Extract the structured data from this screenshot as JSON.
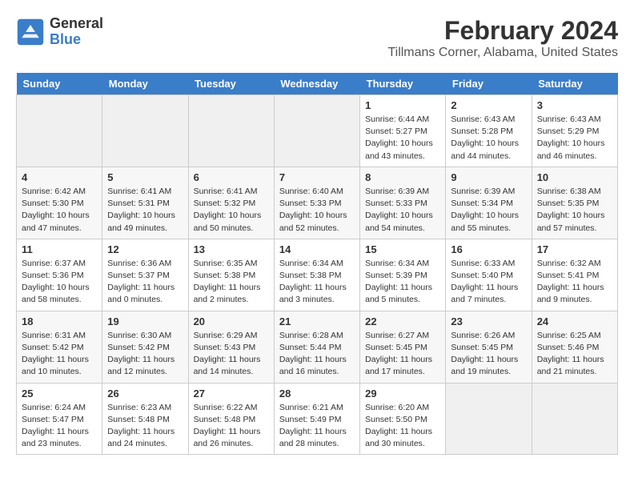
{
  "logo": {
    "text_general": "General",
    "text_blue": "Blue"
  },
  "title": "February 2024",
  "subtitle": "Tillmans Corner, Alabama, United States",
  "days_header": [
    "Sunday",
    "Monday",
    "Tuesday",
    "Wednesday",
    "Thursday",
    "Friday",
    "Saturday"
  ],
  "weeks": [
    [
      {
        "num": "",
        "info": ""
      },
      {
        "num": "",
        "info": ""
      },
      {
        "num": "",
        "info": ""
      },
      {
        "num": "",
        "info": ""
      },
      {
        "num": "1",
        "info": "Sunrise: 6:44 AM\nSunset: 5:27 PM\nDaylight: 10 hours\nand 43 minutes."
      },
      {
        "num": "2",
        "info": "Sunrise: 6:43 AM\nSunset: 5:28 PM\nDaylight: 10 hours\nand 44 minutes."
      },
      {
        "num": "3",
        "info": "Sunrise: 6:43 AM\nSunset: 5:29 PM\nDaylight: 10 hours\nand 46 minutes."
      }
    ],
    [
      {
        "num": "4",
        "info": "Sunrise: 6:42 AM\nSunset: 5:30 PM\nDaylight: 10 hours\nand 47 minutes."
      },
      {
        "num": "5",
        "info": "Sunrise: 6:41 AM\nSunset: 5:31 PM\nDaylight: 10 hours\nand 49 minutes."
      },
      {
        "num": "6",
        "info": "Sunrise: 6:41 AM\nSunset: 5:32 PM\nDaylight: 10 hours\nand 50 minutes."
      },
      {
        "num": "7",
        "info": "Sunrise: 6:40 AM\nSunset: 5:33 PM\nDaylight: 10 hours\nand 52 minutes."
      },
      {
        "num": "8",
        "info": "Sunrise: 6:39 AM\nSunset: 5:33 PM\nDaylight: 10 hours\nand 54 minutes."
      },
      {
        "num": "9",
        "info": "Sunrise: 6:39 AM\nSunset: 5:34 PM\nDaylight: 10 hours\nand 55 minutes."
      },
      {
        "num": "10",
        "info": "Sunrise: 6:38 AM\nSunset: 5:35 PM\nDaylight: 10 hours\nand 57 minutes."
      }
    ],
    [
      {
        "num": "11",
        "info": "Sunrise: 6:37 AM\nSunset: 5:36 PM\nDaylight: 10 hours\nand 58 minutes."
      },
      {
        "num": "12",
        "info": "Sunrise: 6:36 AM\nSunset: 5:37 PM\nDaylight: 11 hours\nand 0 minutes."
      },
      {
        "num": "13",
        "info": "Sunrise: 6:35 AM\nSunset: 5:38 PM\nDaylight: 11 hours\nand 2 minutes."
      },
      {
        "num": "14",
        "info": "Sunrise: 6:34 AM\nSunset: 5:38 PM\nDaylight: 11 hours\nand 3 minutes."
      },
      {
        "num": "15",
        "info": "Sunrise: 6:34 AM\nSunset: 5:39 PM\nDaylight: 11 hours\nand 5 minutes."
      },
      {
        "num": "16",
        "info": "Sunrise: 6:33 AM\nSunset: 5:40 PM\nDaylight: 11 hours\nand 7 minutes."
      },
      {
        "num": "17",
        "info": "Sunrise: 6:32 AM\nSunset: 5:41 PM\nDaylight: 11 hours\nand 9 minutes."
      }
    ],
    [
      {
        "num": "18",
        "info": "Sunrise: 6:31 AM\nSunset: 5:42 PM\nDaylight: 11 hours\nand 10 minutes."
      },
      {
        "num": "19",
        "info": "Sunrise: 6:30 AM\nSunset: 5:42 PM\nDaylight: 11 hours\nand 12 minutes."
      },
      {
        "num": "20",
        "info": "Sunrise: 6:29 AM\nSunset: 5:43 PM\nDaylight: 11 hours\nand 14 minutes."
      },
      {
        "num": "21",
        "info": "Sunrise: 6:28 AM\nSunset: 5:44 PM\nDaylight: 11 hours\nand 16 minutes."
      },
      {
        "num": "22",
        "info": "Sunrise: 6:27 AM\nSunset: 5:45 PM\nDaylight: 11 hours\nand 17 minutes."
      },
      {
        "num": "23",
        "info": "Sunrise: 6:26 AM\nSunset: 5:45 PM\nDaylight: 11 hours\nand 19 minutes."
      },
      {
        "num": "24",
        "info": "Sunrise: 6:25 AM\nSunset: 5:46 PM\nDaylight: 11 hours\nand 21 minutes."
      }
    ],
    [
      {
        "num": "25",
        "info": "Sunrise: 6:24 AM\nSunset: 5:47 PM\nDaylight: 11 hours\nand 23 minutes."
      },
      {
        "num": "26",
        "info": "Sunrise: 6:23 AM\nSunset: 5:48 PM\nDaylight: 11 hours\nand 24 minutes."
      },
      {
        "num": "27",
        "info": "Sunrise: 6:22 AM\nSunset: 5:48 PM\nDaylight: 11 hours\nand 26 minutes."
      },
      {
        "num": "28",
        "info": "Sunrise: 6:21 AM\nSunset: 5:49 PM\nDaylight: 11 hours\nand 28 minutes."
      },
      {
        "num": "29",
        "info": "Sunrise: 6:20 AM\nSunset: 5:50 PM\nDaylight: 11 hours\nand 30 minutes."
      },
      {
        "num": "",
        "info": ""
      },
      {
        "num": "",
        "info": ""
      }
    ]
  ]
}
